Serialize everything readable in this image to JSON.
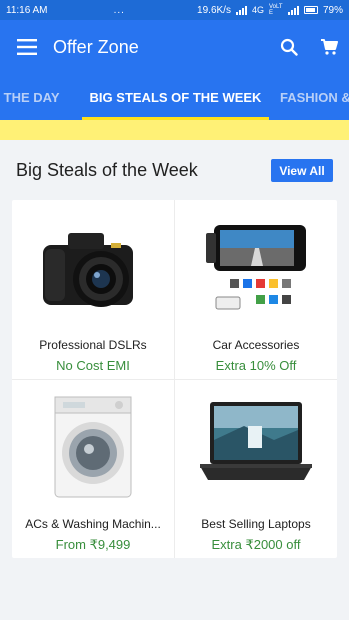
{
  "status": {
    "time": "11:16 AM",
    "dots": "...",
    "speed": "19.6K/s",
    "network": "4G",
    "volte": "VoLTE",
    "battery": "79%"
  },
  "appbar": {
    "title": "Offer Zone",
    "menu_icon": "hamburger-menu-icon",
    "search_icon": "search-icon",
    "cart_icon": "cart-icon"
  },
  "tabs": {
    "left": "OF THE DAY",
    "active": "BIG STEALS OF THE WEEK",
    "right": "FASHION &"
  },
  "colors": {
    "brand": "#2874f0",
    "banner": "#fff176",
    "offer": "#388e3c",
    "tab_indicator": "#ffe11b"
  },
  "section": {
    "title": "Big Steals of the Week",
    "view_all": "View All"
  },
  "products": [
    {
      "name": "Professional DSLRs",
      "offer": "No Cost EMI",
      "image": "dslr-camera"
    },
    {
      "name": "Car Accessories",
      "offer": "Extra 10% Off",
      "image": "car-monitor"
    },
    {
      "name": "ACs & Washing Machin...",
      "offer": "From ₹9,499",
      "image": "washing-machine"
    },
    {
      "name": "Best Selling Laptops",
      "offer": "Extra ₹2000 off",
      "image": "laptop"
    }
  ]
}
